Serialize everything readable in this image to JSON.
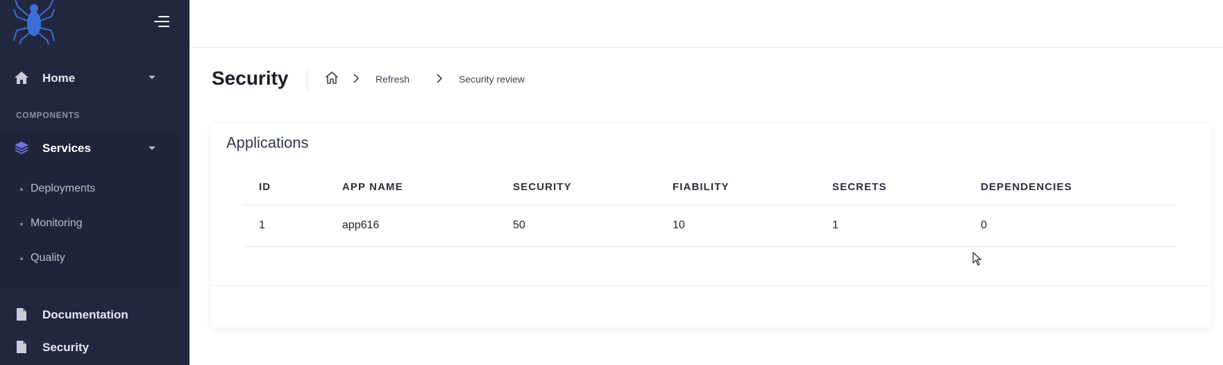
{
  "sidebar": {
    "logo_icon": "spider-logo-icon",
    "toggle_icon": "menu-toggle-icon",
    "home": {
      "label": "Home",
      "icon": "home-icon"
    },
    "section_label": "COMPONENTS",
    "services": {
      "label": "Services",
      "icon": "layers-icon",
      "items": [
        {
          "label": "Deployments"
        },
        {
          "label": "Monitoring"
        },
        {
          "label": "Quality"
        }
      ]
    },
    "documentation": {
      "label": "Documentation",
      "icon": "file-icon"
    },
    "security": {
      "label": "Security",
      "icon": "file-icon"
    }
  },
  "header": {
    "title": "Security",
    "breadcrumb": {
      "home_icon": "home-outline-icon",
      "items": [
        "Refresh",
        "Security review"
      ]
    }
  },
  "applications": {
    "title": "Applications",
    "columns": [
      "ID",
      "APP NAME",
      "SECURITY",
      "FIABILITY",
      "SECRETS",
      "DEPENDENCIES"
    ],
    "rows": [
      {
        "id": "1",
        "app_name": "app616",
        "security": "50",
        "fiability": "10",
        "secrets": "1",
        "dependencies": "0"
      }
    ]
  },
  "colors": {
    "sidebar_bg": "#222740",
    "services_block_bg": "#1f2439",
    "accent_icon": "#6c74e6",
    "logo_blue": "#3b6fd8"
  }
}
